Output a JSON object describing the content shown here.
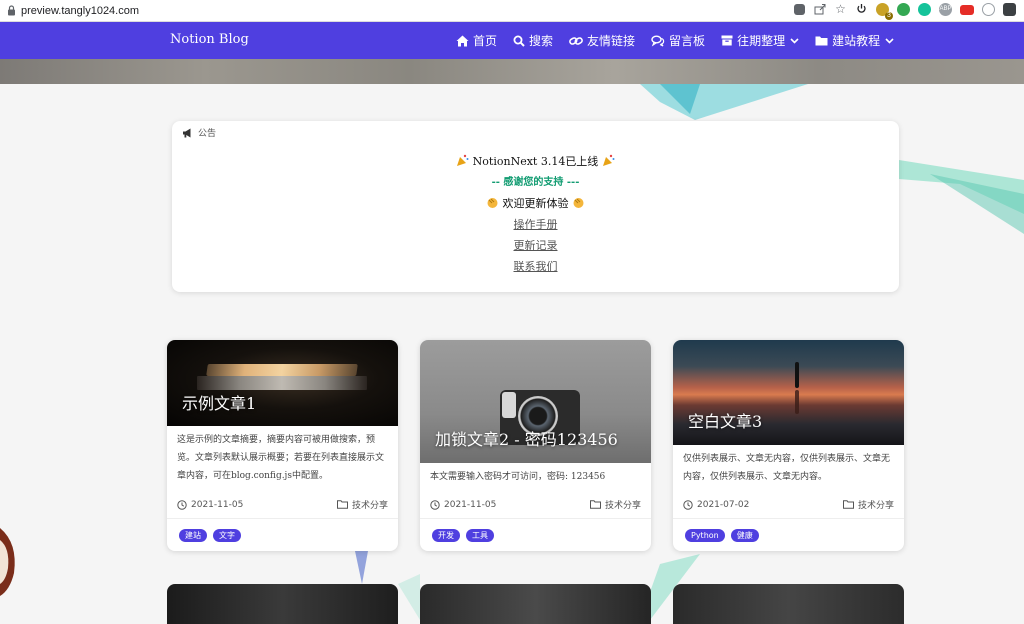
{
  "browser": {
    "url": "preview.tangly1024.com",
    "extension_icons": [
      "translate-icon",
      "share-icon",
      "star-icon",
      "power-icon",
      "badge-extension-icon",
      "green-extension-icon",
      "grammarly-icon",
      "adblock-icon",
      "youtube-icon",
      "circle-extension-icon",
      "profile-icon"
    ],
    "badge_count": "3"
  },
  "nav": {
    "brand": "Notion Blog",
    "items": [
      {
        "label": "首页",
        "icon": "home-icon",
        "dropdown": false
      },
      {
        "label": "搜索",
        "icon": "search-icon",
        "dropdown": false
      },
      {
        "label": "友情链接",
        "icon": "link-icon",
        "dropdown": false
      },
      {
        "label": "留言板",
        "icon": "comments-icon",
        "dropdown": false
      },
      {
        "label": "往期整理",
        "icon": "archive-icon",
        "dropdown": true
      },
      {
        "label": "建站教程",
        "icon": "folder-icon",
        "dropdown": true
      }
    ]
  },
  "notice": {
    "heading": "公告",
    "title": "NotionNext 3.14已上线",
    "subtitle": "-- 感谢您的支持 ---",
    "welcome": "欢迎更新体验",
    "links": [
      "操作手册",
      "更新记录",
      "联系我们"
    ]
  },
  "posts": [
    {
      "title": "示例文章1",
      "summary": "这是示例的文章摘要，摘要内容可被用做搜索，预览。文章列表默认展示概要；若要在列表直接展示文章内容，可在blog.config.js中配置。",
      "date": "2021-11-05",
      "category": "技术分享",
      "tags": [
        "建站",
        "文字"
      ]
    },
    {
      "title": "加锁文章2 - 密码123456",
      "summary": "本文需要输入密码才可访问，密码: 123456",
      "date": "2021-11-05",
      "category": "技术分享",
      "tags": [
        "开发",
        "工具"
      ]
    },
    {
      "title": "空白文章3",
      "summary": "仅供列表展示、文章无内容，仅供列表展示、文章无内容，仅供列表展示、文章无内容。",
      "date": "2021-07-02",
      "category": "技术分享",
      "tags": [
        "Python",
        "健康"
      ]
    }
  ],
  "colors": {
    "accent": "#4f3fe0",
    "notice_green": "#129c72",
    "card_bg": "#ffffff",
    "page_bg": "#f5f5f5"
  }
}
